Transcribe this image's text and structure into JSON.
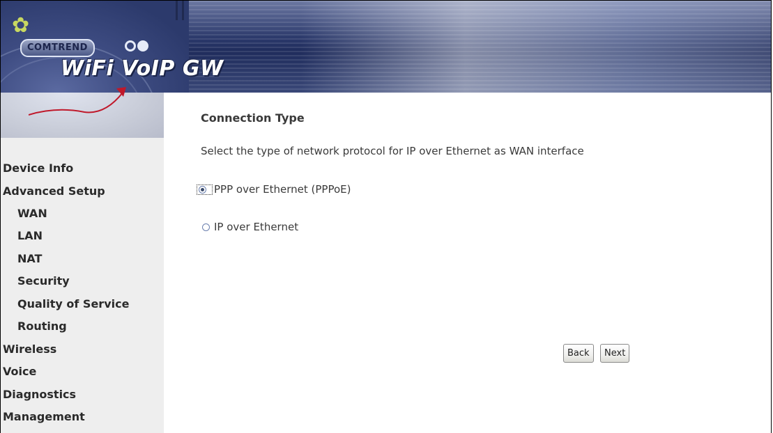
{
  "header": {
    "brand": "COMTREND",
    "product": "WiFi VoIP GW"
  },
  "sidebar": {
    "items": [
      {
        "label": "Device Info",
        "level": 0
      },
      {
        "label": "Advanced Setup",
        "level": 0
      },
      {
        "label": "WAN",
        "level": 1
      },
      {
        "label": "LAN",
        "level": 1
      },
      {
        "label": "NAT",
        "level": 1
      },
      {
        "label": "Security",
        "level": 1
      },
      {
        "label": "Quality of Service",
        "level": 1
      },
      {
        "label": "Routing",
        "level": 1
      },
      {
        "label": "Wireless",
        "level": 0
      },
      {
        "label": "Voice",
        "level": 0
      },
      {
        "label": "Diagnostics",
        "level": 0
      },
      {
        "label": "Management",
        "level": 0
      }
    ]
  },
  "main": {
    "title": "Connection Type",
    "intro": "Select the type of network protocol for IP over Ethernet as WAN interface",
    "options": [
      {
        "label": "PPP over Ethernet (PPPoE)",
        "checked": true
      },
      {
        "label": "IP over Ethernet",
        "checked": false
      }
    ],
    "buttons": {
      "back": "Back",
      "next": "Next"
    }
  },
  "colors": {
    "header_blue": "#2c3a6c",
    "sidebar_bg": "#eeeeee",
    "text": "#3a3a3a"
  }
}
